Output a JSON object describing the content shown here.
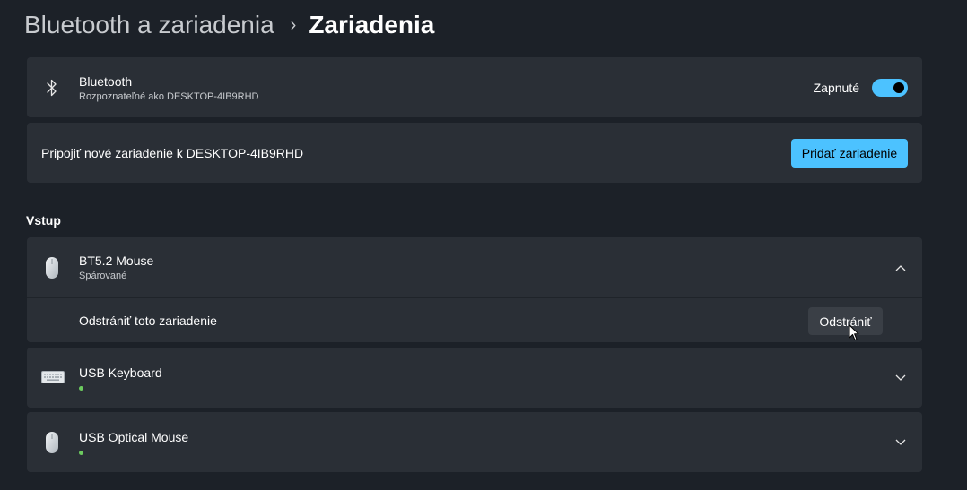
{
  "breadcrumb": {
    "parent": "Bluetooth a zariadenia",
    "separator": "›",
    "current": "Zariadenia"
  },
  "bluetooth": {
    "icon": "bluetooth-icon",
    "title": "Bluetooth",
    "subtitle": "Rozpoznateľné ako DESKTOP-4IB9RHD",
    "toggle_label": "Zapnuté",
    "toggle_on": true
  },
  "connect": {
    "label": "Pripojiť nové zariadenie k DESKTOP-4IB9RHD",
    "button_label": "Pridať zariadenie"
  },
  "section_label": "Vstup",
  "devices": [
    {
      "icon": "mouse-icon",
      "name": "BT5.2 Mouse",
      "status": "Spárované",
      "expanded": true,
      "remove_label": "Odstrániť toto zariadenie",
      "remove_button": "Odstrániť"
    },
    {
      "icon": "keyboard-icon",
      "name": "USB Keyboard",
      "connected": true
    },
    {
      "icon": "mouse-icon",
      "name": "USB Optical Mouse",
      "connected": true
    }
  ],
  "colors": {
    "background": "#1c2128",
    "card": "#2a2f36",
    "accent": "#4cc2ff",
    "status_green": "#6ccb5f"
  }
}
